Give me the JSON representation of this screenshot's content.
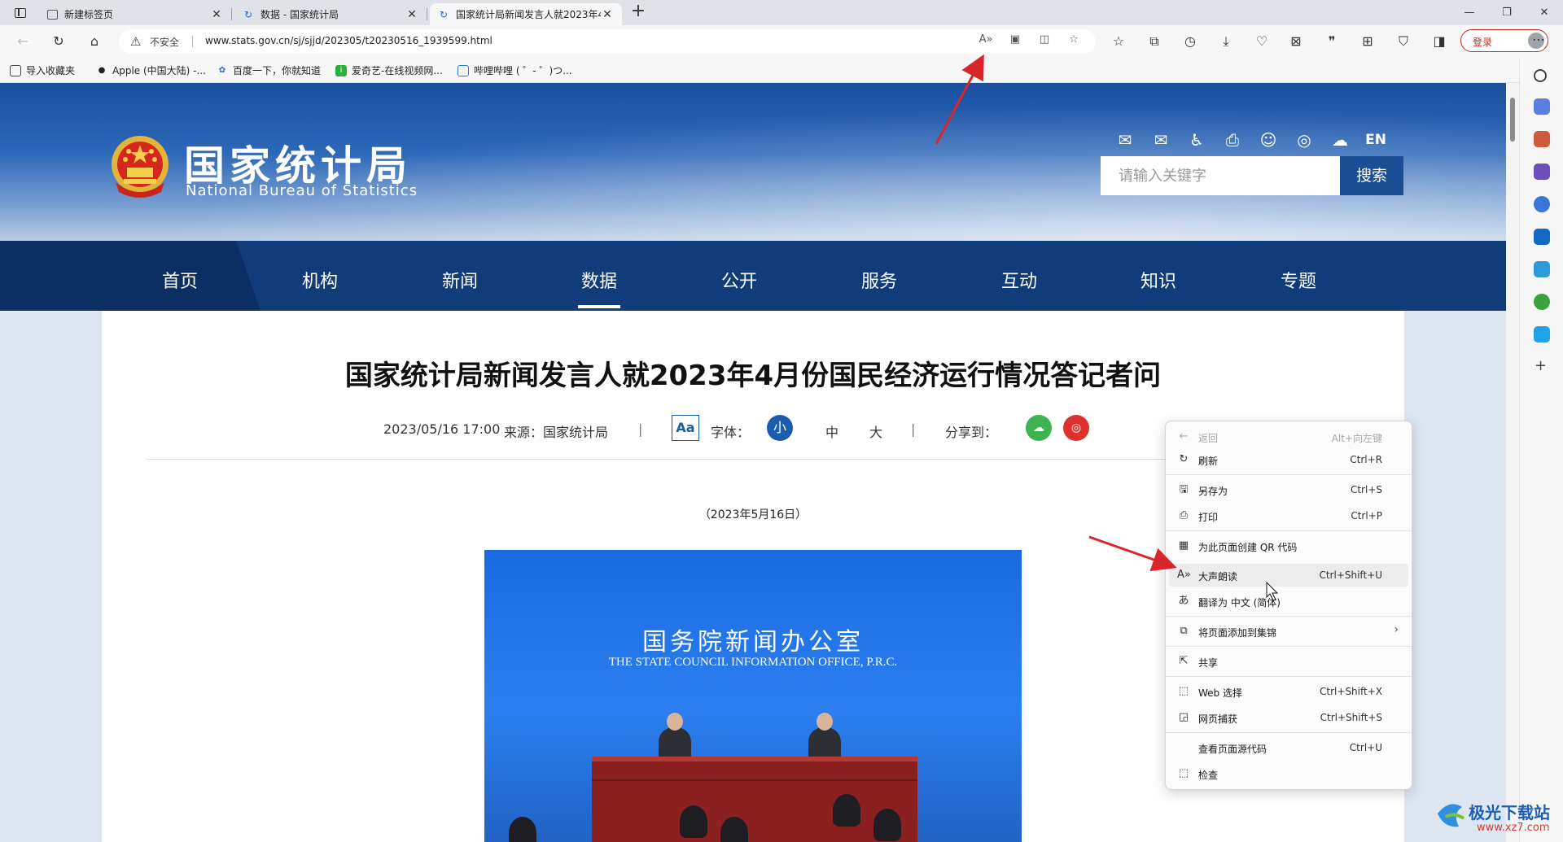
{
  "browser": {
    "tabs": [
      {
        "title": "新建标签页",
        "active": false,
        "icon": "page-icon"
      },
      {
        "title": "数据 - 国家统计局",
        "active": false,
        "icon": "loading-icon"
      },
      {
        "title": "国家统计局新闻发言人就2023年4",
        "active": true,
        "icon": "loading-icon"
      }
    ],
    "new_tab_glyph": "+",
    "address": {
      "security_label": "不安全",
      "url": "www.stats.gov.cn/sj/sjjd/202305/t20230516_1939599.html"
    },
    "login_label": "登录",
    "favorites": [
      {
        "label": "导入收藏夹",
        "icon": "import-icon"
      },
      {
        "label": "Apple (中国大陆) -...",
        "icon": "apple-icon"
      },
      {
        "label": "百度一下，你就知道",
        "icon": "baidu-icon"
      },
      {
        "label": "爱奇艺-在线视频网...",
        "icon": "iqiyi-icon"
      },
      {
        "label": "哔哩哔哩 ( ゜- ゜)つ...",
        "icon": "bilibili-icon"
      }
    ]
  },
  "site": {
    "name_cn": "国家统计局",
    "name_en": "National Bureau of Statistics",
    "header_icons": [
      "mail-icon",
      "mail-send-icon",
      "accessibility-icon",
      "print-icon",
      "robot-icon",
      "weibo-icon",
      "wechat-icon"
    ],
    "lang_label": "EN",
    "search": {
      "placeholder": "请输入关键字",
      "button": "搜索"
    },
    "nav": [
      "首页",
      "机构",
      "新闻",
      "数据",
      "公开",
      "服务",
      "互动",
      "知识",
      "专题"
    ],
    "nav_active": "数据"
  },
  "article": {
    "title": "国家统计局新闻发言人就2023年4月份国民经济运行情况答记者问",
    "datetime": "2023/05/16 17:00",
    "source": "来源：国家统计局",
    "sep": "|",
    "font_icon_label": "Aa",
    "font_label": "字体：",
    "sizes": [
      "小",
      "中",
      "大"
    ],
    "share_label": "分享到：",
    "date_line": "（2023年5月16日）",
    "photo": {
      "title_cn": "国务院新闻办公室",
      "title_en": "THE STATE COUNCIL INFORMATION OFFICE, P.R.C."
    }
  },
  "context_menu": {
    "items": [
      {
        "label": "返回",
        "shortcut": "Alt+向左键",
        "icon": "back-arrow-icon",
        "disabled": true
      },
      {
        "label": "刷新",
        "shortcut": "Ctrl+R",
        "icon": "refresh-icon"
      },
      {
        "label": "另存为",
        "shortcut": "Ctrl+S",
        "icon": "save-as-icon"
      },
      {
        "label": "打印",
        "shortcut": "Ctrl+P",
        "icon": "print-icon"
      },
      {
        "label": "为此页面创建 QR 代码",
        "shortcut": "",
        "icon": "qr-code-icon"
      },
      {
        "label": "大声朗读",
        "shortcut": "Ctrl+Shift+U",
        "icon": "read-aloud-icon",
        "highlighted": true
      },
      {
        "label": "翻译为 中文 (简体)",
        "shortcut": "",
        "icon": "translate-icon"
      },
      {
        "label": "将页面添加到集锦",
        "shortcut": "",
        "icon": "collections-icon",
        "submenu": true
      },
      {
        "label": "共享",
        "shortcut": "",
        "icon": "share-icon"
      },
      {
        "label": "Web 选择",
        "shortcut": "Ctrl+Shift+X",
        "icon": "web-select-icon"
      },
      {
        "label": "网页捕获",
        "shortcut": "Ctrl+Shift+S",
        "icon": "web-capture-icon"
      },
      {
        "label": "查看页面源代码",
        "shortcut": "Ctrl+U",
        "icon": ""
      },
      {
        "label": "检查",
        "shortcut": "",
        "icon": "inspect-icon"
      }
    ]
  },
  "watermark": {
    "name": "极光下载站",
    "url": "www.xz7.com"
  },
  "colors": {
    "nav_bg": "#113c7a",
    "accent_blue": "#1b5cae",
    "annotation_red": "#d8262a",
    "login_red": "#c42b1c"
  }
}
